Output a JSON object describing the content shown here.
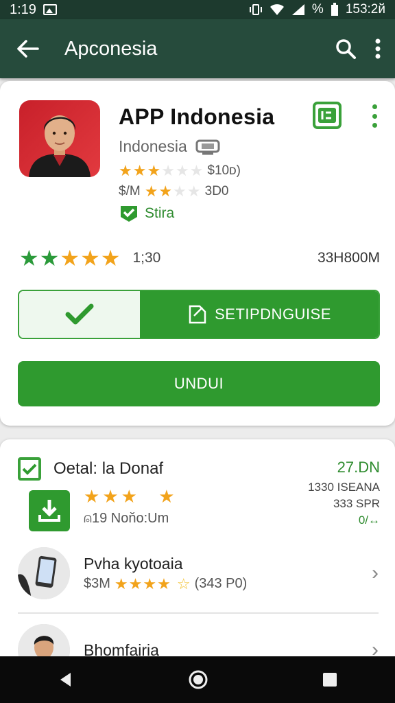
{
  "status_bar": {
    "time": "1:19",
    "battery_text": "%",
    "clock_right": "153:2й"
  },
  "app_bar": {
    "title": "Apconesia",
    "icons": [
      "back-arrow-icon",
      "search-icon",
      "more-vert-icon"
    ]
  },
  "app": {
    "name": "APP Indonesia",
    "developer": "Indonesia",
    "line3_tail": "$10ᴅ)",
    "line4_prefix": "$/M",
    "line4_tail": "3D0",
    "badge_text": "Stira"
  },
  "rating": {
    "stars_shown": 5,
    "count": "1;30",
    "size": "33H800M"
  },
  "buttons": {
    "secondary_label": "SETIPDNGUISE",
    "install_label": "UNDUI"
  },
  "details": {
    "title": "Oetal: la Donaf",
    "sub": "⍝19 Noňo:Um",
    "right_1": "27.DN",
    "right_2": "1330 ISEANA",
    "right_3": "333 SPR",
    "right_4": "0/↔"
  },
  "list": [
    {
      "title": "Pvha kyotoaia",
      "price": "$3M",
      "tail": "(343 P0)"
    },
    {
      "title": "Bhomfairia"
    }
  ],
  "colors": {
    "primary_green": "#2f9a2f",
    "appbar": "#264b3c",
    "star_orange": "#f2a31b"
  }
}
